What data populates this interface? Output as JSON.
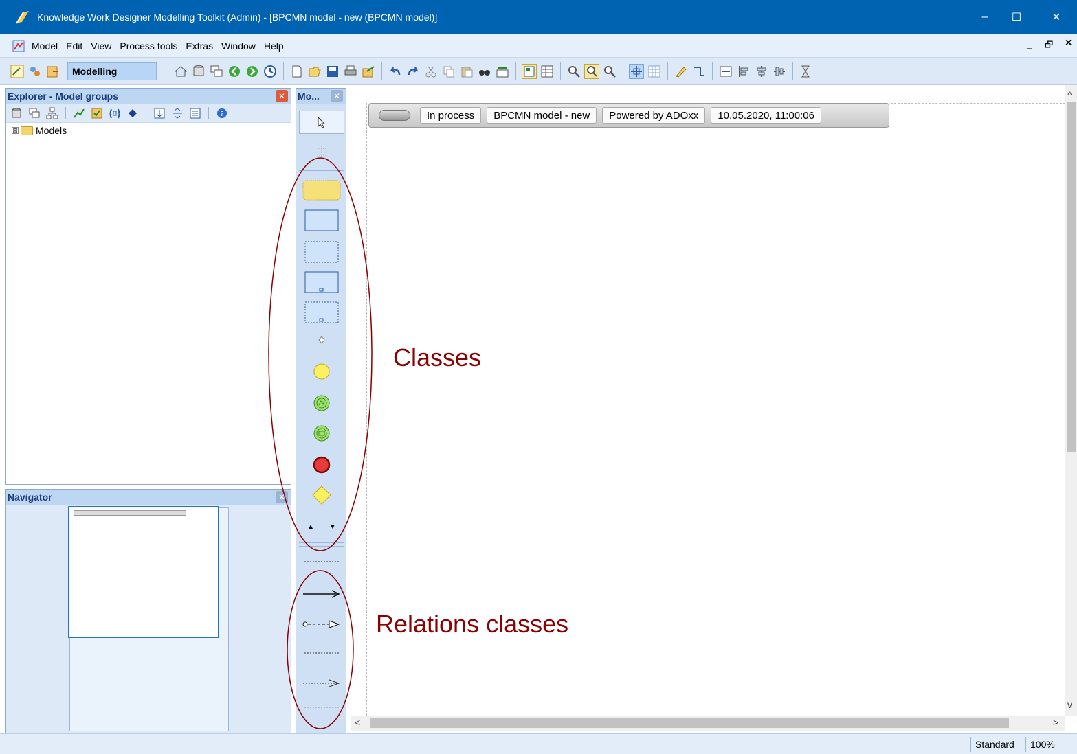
{
  "window": {
    "title": "Knowledge Work Designer Modelling Toolkit (Admin) - [BPCMN model - new (BPCMN model)]",
    "minimize": "–",
    "maximize": "☐",
    "close": "✕"
  },
  "menu": {
    "items": [
      "Model",
      "Edit",
      "View",
      "Process tools",
      "Extras",
      "Window",
      "Help"
    ],
    "mdi_minimize": "_",
    "mdi_restore": "🗗",
    "mdi_close": "×"
  },
  "toolbar": {
    "mode_label": "Modelling"
  },
  "explorer": {
    "title": "Explorer - Model groups",
    "close": "✕",
    "tree": [
      {
        "expander": "⊞",
        "label": "Models"
      }
    ]
  },
  "navigator": {
    "title": "Navigator",
    "close": "✕"
  },
  "palette": {
    "title": "Mo...",
    "close": "✕",
    "scroll_up": "▲",
    "scroll_down": "▼"
  },
  "model_header": {
    "status": "In process",
    "model_name": "BPCMN model - new",
    "powered_by": "Powered by ADOxx",
    "timestamp": "10.05.2020, 11:00:06"
  },
  "statusbar": {
    "mode": "Standard",
    "zoom": "100%"
  },
  "annotations": {
    "classes": "Classes",
    "relations": "Relations classes"
  },
  "colors": {
    "titlebar": "#0063b1",
    "annotation": "#8b0000",
    "palette_bg": "#cfe0f5"
  }
}
